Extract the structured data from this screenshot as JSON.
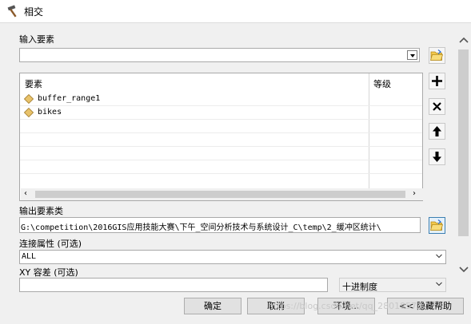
{
  "window": {
    "title": "相交"
  },
  "input_features": {
    "label": "输入要素",
    "value": ""
  },
  "features_table": {
    "columns": [
      "要素",
      "等级"
    ],
    "rows": [
      {
        "name": "buffer_range1",
        "rank": ""
      },
      {
        "name": "bikes",
        "rank": ""
      }
    ]
  },
  "output_feature_class": {
    "label": "输出要素类",
    "value": "G:\\competition\\2016GIS应用技能大赛\\下午_空间分析技术与系统设计_C\\temp\\2_缓冲区统计\\"
  },
  "join_attributes": {
    "label": "连接属性 (可选)",
    "value": "ALL"
  },
  "xy_tolerance": {
    "label": "XY 容差 (可选)",
    "value": "",
    "unit": "十进制度"
  },
  "buttons": {
    "ok": "确定",
    "cancel": "取消",
    "environments": "环境...",
    "hide_help": "<< 隐藏帮助"
  },
  "watermark": "https://blog.csdn.net/qq_28019573"
}
